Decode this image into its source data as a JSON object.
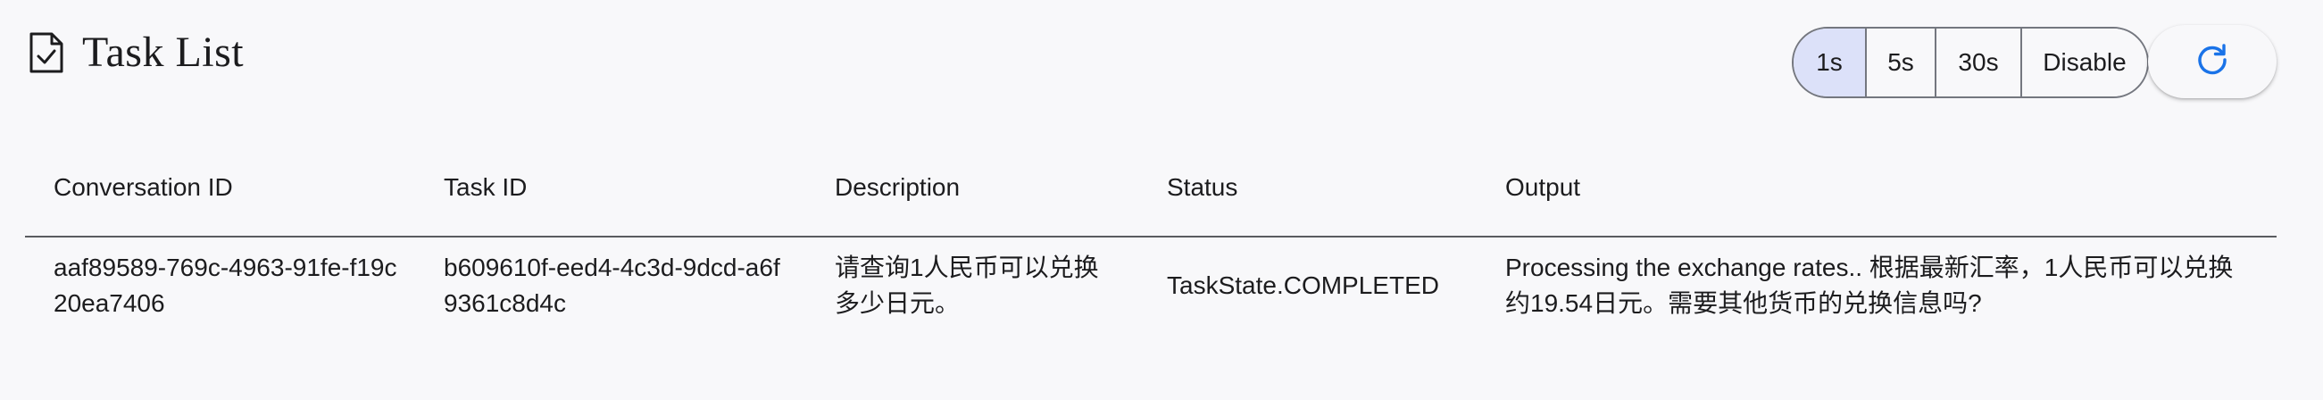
{
  "page": {
    "title": "Task List",
    "title_icon": "task-check-icon"
  },
  "refresh_controls": {
    "intervals": [
      {
        "label": "1s",
        "selected": true
      },
      {
        "label": "5s",
        "selected": false
      },
      {
        "label": "30s",
        "selected": false
      },
      {
        "label": "Disable",
        "selected": false
      }
    ],
    "refresh_icon": "refresh-icon",
    "accent_color": "#1a73e8",
    "selected_color": "#dce1f9"
  },
  "table": {
    "columns": [
      "Conversation ID",
      "Task ID",
      "Description",
      "Status",
      "Output"
    ],
    "rows": [
      {
        "conversation_id": "aaf89589-769c-4963-91fe-f19c20ea7406",
        "task_id": "b609610f-eed4-4c3d-9dcd-a6f9361c8d4c",
        "description": "请查询1人民币可以兑换多少日元。",
        "status": "TaskState.COMPLETED",
        "output": "Processing the exchange rates.. 根据最新汇率，1人民币可以兑换约19.54日元。需要其他货币的兑换信息吗?"
      }
    ]
  }
}
